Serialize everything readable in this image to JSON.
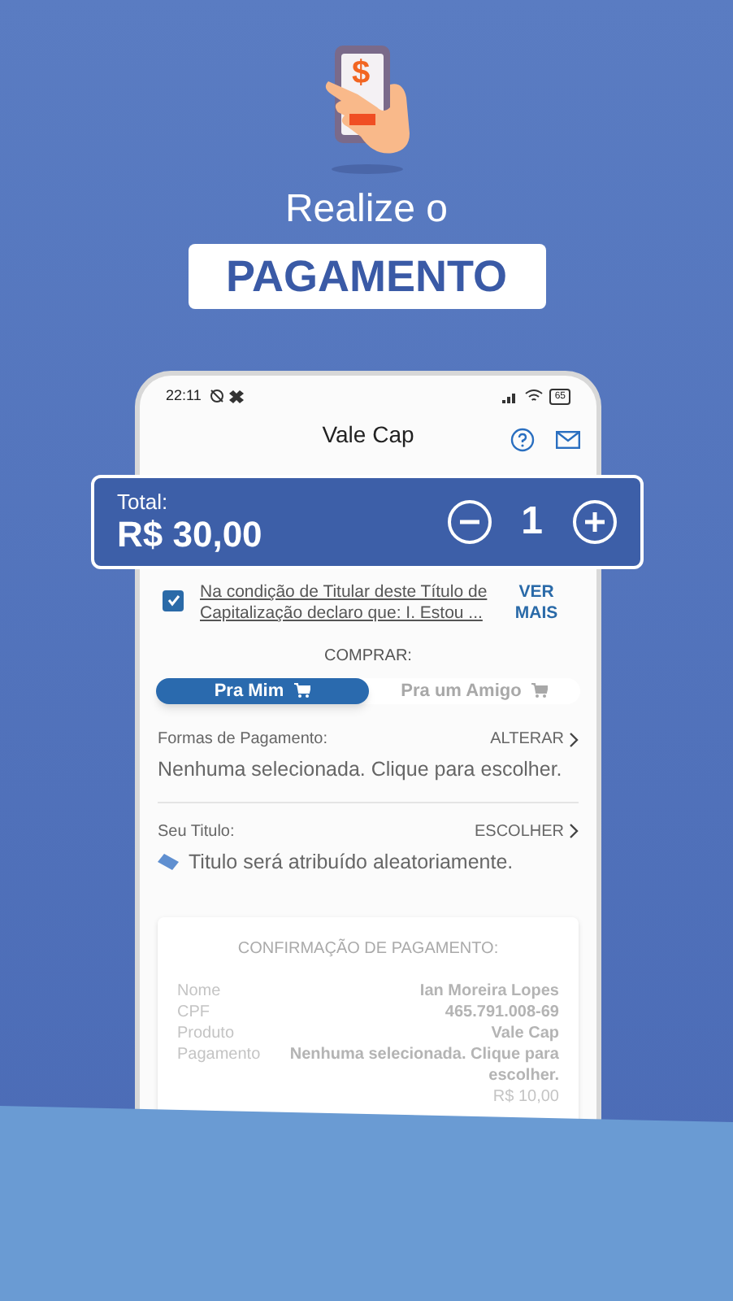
{
  "hero": {
    "icon_symbol": "$",
    "line_1": "Realize o",
    "line_2": "PAGAMENTO"
  },
  "status_bar": {
    "time": "22:11",
    "battery": "65"
  },
  "app_bar": {
    "title": "Vale Cap"
  },
  "total_bar": {
    "label": "Total:",
    "amount": "R$ 30,00",
    "quantity": "1"
  },
  "terms": {
    "checked": true,
    "text": "Na condição de Titular deste Título de Capitalização declaro que: I. Estou ...",
    "link": "VER MAIS"
  },
  "buy_for": {
    "label": "COMPRAR:",
    "options": [
      {
        "label": "Pra Mim",
        "selected": true
      },
      {
        "label": "Pra um Amigo",
        "selected": false
      }
    ]
  },
  "sections": [
    {
      "label": "Formas de Pagamento:",
      "action": "ALTERAR",
      "value": "Nenhuma selecionada. Clique para escolher.",
      "kind": "plain"
    },
    {
      "label": "Seu Titulo:",
      "action": "ESCOLHER",
      "value": "Titulo será atribuído aleatoriamente.",
      "kind": "ticket"
    }
  ],
  "confirmation": {
    "title": "CONFIRMAÇÃO DE PAGAMENTO:",
    "rows": [
      {
        "label": "Nome",
        "value": "Ian Moreira Lopes"
      },
      {
        "label": "CPF",
        "value": "465.791.008-69"
      },
      {
        "label": "Produto",
        "value": "Vale Cap"
      },
      {
        "label": "Pagamento",
        "value": "Nenhuma selecionada. Clique para escolher."
      },
      {
        "label": "",
        "value": "R$ 10,00"
      }
    ]
  }
}
